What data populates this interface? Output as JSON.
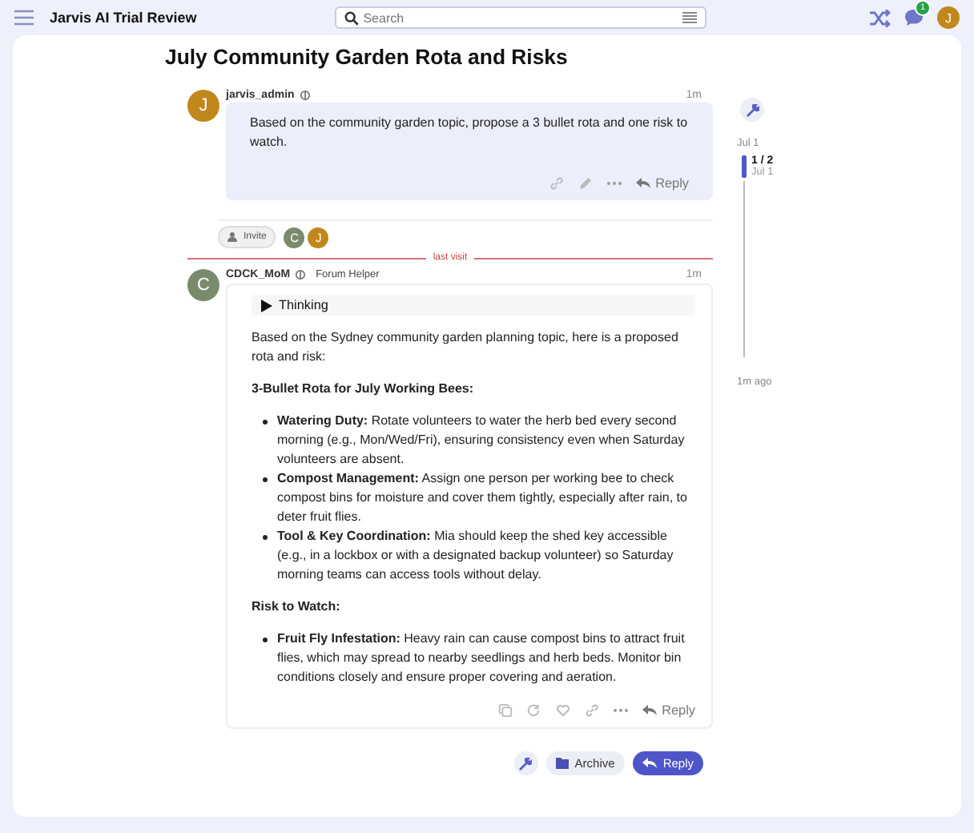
{
  "header": {
    "site_title": "Jarvis AI Trial Review",
    "search_placeholder": "Search",
    "notification_count": "1",
    "avatar_letter": "J"
  },
  "topic": {
    "title": "July Community Garden Rota and Risks"
  },
  "question": {
    "author": "jarvis_admin",
    "avatar_letter": "J",
    "time": "1m",
    "body": "Based on the community garden topic, propose a 3 bullet rota and one risk to watch.",
    "reply_label": "Reply"
  },
  "participants": {
    "invite_label": "Invite",
    "avatars": [
      {
        "letter": "C",
        "color": "#7a8b6c"
      },
      {
        "letter": "J",
        "color": "#c0871c"
      }
    ]
  },
  "last_visit": "last visit",
  "answer": {
    "author": "CDCK_MoM",
    "flair": "Forum Helper",
    "avatar_letter": "C",
    "time": "1m",
    "thinking_label": "Thinking",
    "reply_label": "Reply",
    "blocks": [
      {
        "kind": "paragraph",
        "text": "Based on the Sydney community garden planning topic, here is a proposed rota and risk:"
      },
      {
        "kind": "heading",
        "text": "3-Bullet Rota for July Working Bees:"
      },
      {
        "kind": "list",
        "items": [
          "**Watering Duty:** Rotate volunteers to water the herb bed every second morning (e.g., Mon/Wed/Fri), ensuring consistency even when Saturday volunteers are absent.",
          "**Compost Management:** Assign one person per working bee to check compost bins for moisture and cover them tightly, especially after rain, to deter fruit flies.",
          "**Tool & Key Coordination:** Mia should keep the shed key accessible (e.g., in a lockbox or with a designated backup volunteer) so Saturday morning teams can access tools without delay."
        ]
      },
      {
        "kind": "heading",
        "text": "Risk to Watch:"
      },
      {
        "kind": "list",
        "items": [
          "**Fruit Fly Infestation:** Heavy rain can cause compost bins to attract fruit flies, which may spread to nearby seedlings and herb beds. Monitor bin conditions closely and ensure proper covering and aeration."
        ]
      }
    ]
  },
  "timeline": {
    "start": "Jul 1",
    "position": "1 / 2",
    "position_date": "Jul 1",
    "end": "1m ago"
  },
  "footer": {
    "archive_label": "Archive",
    "reply_label": "Reply"
  }
}
